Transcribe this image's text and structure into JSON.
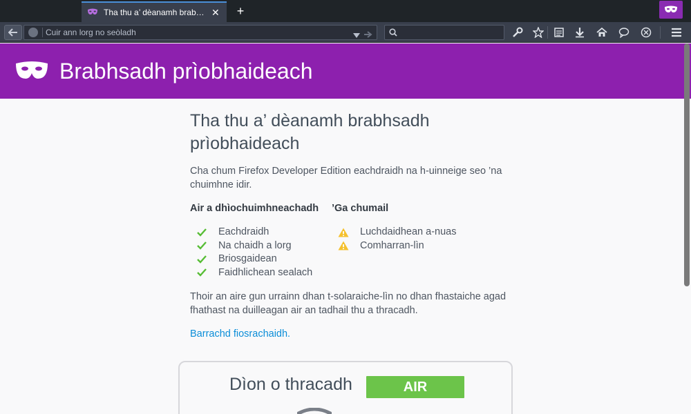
{
  "colors": {
    "tabstrip_bg": "#1f2428",
    "toolbar_bg": "#393f4c",
    "private_purple": "#8d20ae",
    "status_green": "#6cc44a",
    "link_blue": "#0a8dd8",
    "warning_yellow": "#f5c12e"
  },
  "tab": {
    "title": "Tha thu a’ dèanamh brabhsadh prìobhaideach",
    "favicon": "private-mask-icon",
    "close": "✕"
  },
  "toolbar": {
    "new_tab": "+",
    "url_placeholder": "Cuir ann lorg no seòladh",
    "search_placeholder": "",
    "icons": [
      "wrench-icon",
      "star-icon",
      "reading-list-icon",
      "download-icon",
      "home-icon",
      "chat-icon",
      "devtools-icon",
      "menu-icon"
    ]
  },
  "header": {
    "title": "Brabhsadh prìobhaideach"
  },
  "main": {
    "title": "Tha thu a’ dèanamh brabhsadh prìobhaideach",
    "intro": "Cha chum Firefox Developer Edition eachdraidh na h-uinneige seo ’na chuimhne idir.",
    "forgets_heading": "Air a dhìochuimhneachadh",
    "saves_heading": "’Ga chumail",
    "forgets": [
      "Eachdraidh",
      "Na chaidh a lorg",
      "Briosgaidean",
      "Faidhlichean sealach"
    ],
    "saves": [
      "Luchdaidhean a-nuas",
      "Comharran-lìn"
    ],
    "note": "Thoir an aire gun urrainn dhan t-solaraiche-lìn no dhan fhastaiche agad fhathast na duilleagan air an tadhail thu a thracadh.",
    "learn_more": "Barrachd fiosrachaidh."
  },
  "tracking_protection": {
    "title": "Dìon o thracadh",
    "status": "AIR"
  }
}
